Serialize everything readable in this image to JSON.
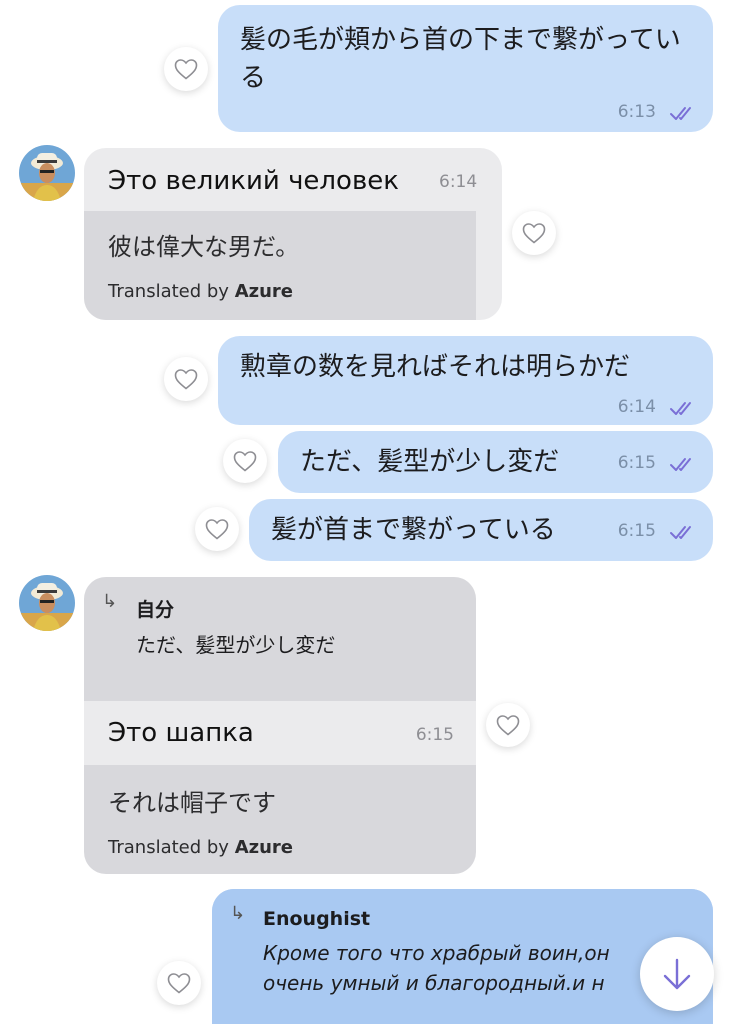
{
  "messages": {
    "m1": {
      "text": "髪の毛が頬から首の下まで繋がっている",
      "time": "6:13"
    },
    "m2": {
      "text": "Это великий человек",
      "time": "6:14",
      "translation": "彼は偉大な男だ。",
      "translated_by_prefix": "Translated by",
      "translated_by_service": "Azure"
    },
    "m3": {
      "text": "勲章の数を見ればそれは明らかだ",
      "time": "6:14"
    },
    "m4": {
      "text": "ただ、髪型が少し変だ",
      "time": "6:15"
    },
    "m5": {
      "text": "髪が首まで繋がっている",
      "time": "6:15"
    },
    "m6": {
      "reply_name": "自分",
      "reply_text": "ただ、髪型が少し変だ",
      "text": "Это шапка",
      "time": "6:15",
      "translation": "それは帽子です",
      "translated_by_prefix": "Translated by",
      "translated_by_service": "Azure"
    },
    "m7": {
      "reply_name": "Enoughist",
      "reply_line1": "Кроме того что храбрый воин,он",
      "reply_line2": "очень умный и благородный.и н"
    }
  },
  "icons": {
    "heart": "heart-icon",
    "read_ticks": "double-check-icon",
    "reply": "reply-arrow-icon",
    "scroll_down": "arrow-down-icon"
  },
  "colors": {
    "outgoing_bubble": "#c8def9",
    "incoming_bubble": "#ebebed",
    "translation_box": "#d8d8dc",
    "ticks": "#7a6fd6"
  }
}
